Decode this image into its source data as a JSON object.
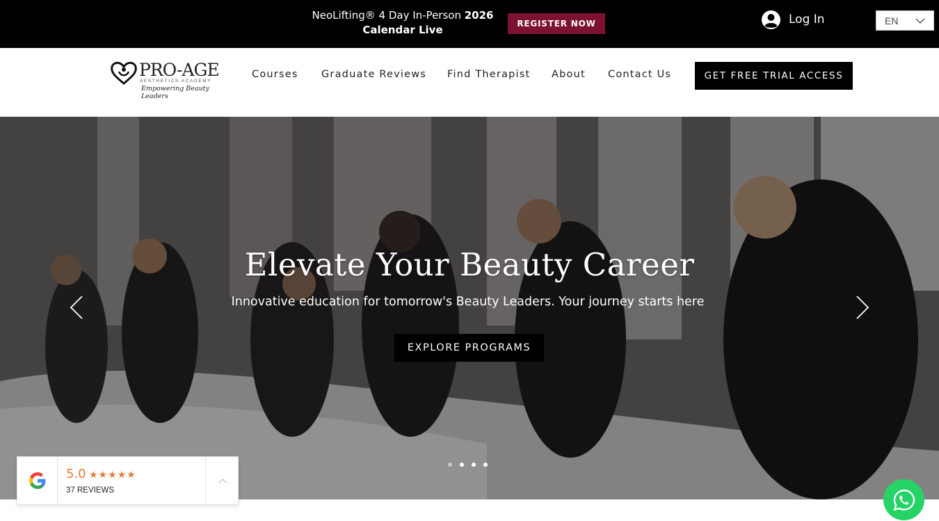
{
  "announcement": {
    "line1_text": "NeoLifting® 4 Day In-Person ",
    "line1_bold": "2026",
    "line2": "Calendar Live",
    "register_label": "REGISTER NOW"
  },
  "account": {
    "login_label": "Log In"
  },
  "language": {
    "selected": "EN"
  },
  "header": {
    "logo": {
      "main": "PRO-AGE",
      "sub": "AESTHETICS ACADEMY",
      "tagline": "Empowering Beauty Leaders"
    },
    "nav": [
      {
        "label": "Courses"
      },
      {
        "label": "Graduate Reviews"
      },
      {
        "label": "Find Therapist"
      },
      {
        "label": "About"
      },
      {
        "label": "Contact Us"
      }
    ],
    "cta_label": "GET FREE TRIAL ACCESS"
  },
  "hero": {
    "title": "Elevate Your Beauty Career",
    "subtitle": "Innovative education for tomorrow's Beauty Leaders. Your journey starts here",
    "button_label": "EXPLORE PROGRAMS",
    "slides_count": 4,
    "active_slide": 2
  },
  "reviews": {
    "score": "5.0",
    "stars": "★★★★★",
    "count_label": "37 REVIEWS"
  },
  "colors": {
    "topbar": "#000000",
    "register": "#7d1230",
    "star": "#e07b39",
    "whatsapp": "#25d366"
  }
}
